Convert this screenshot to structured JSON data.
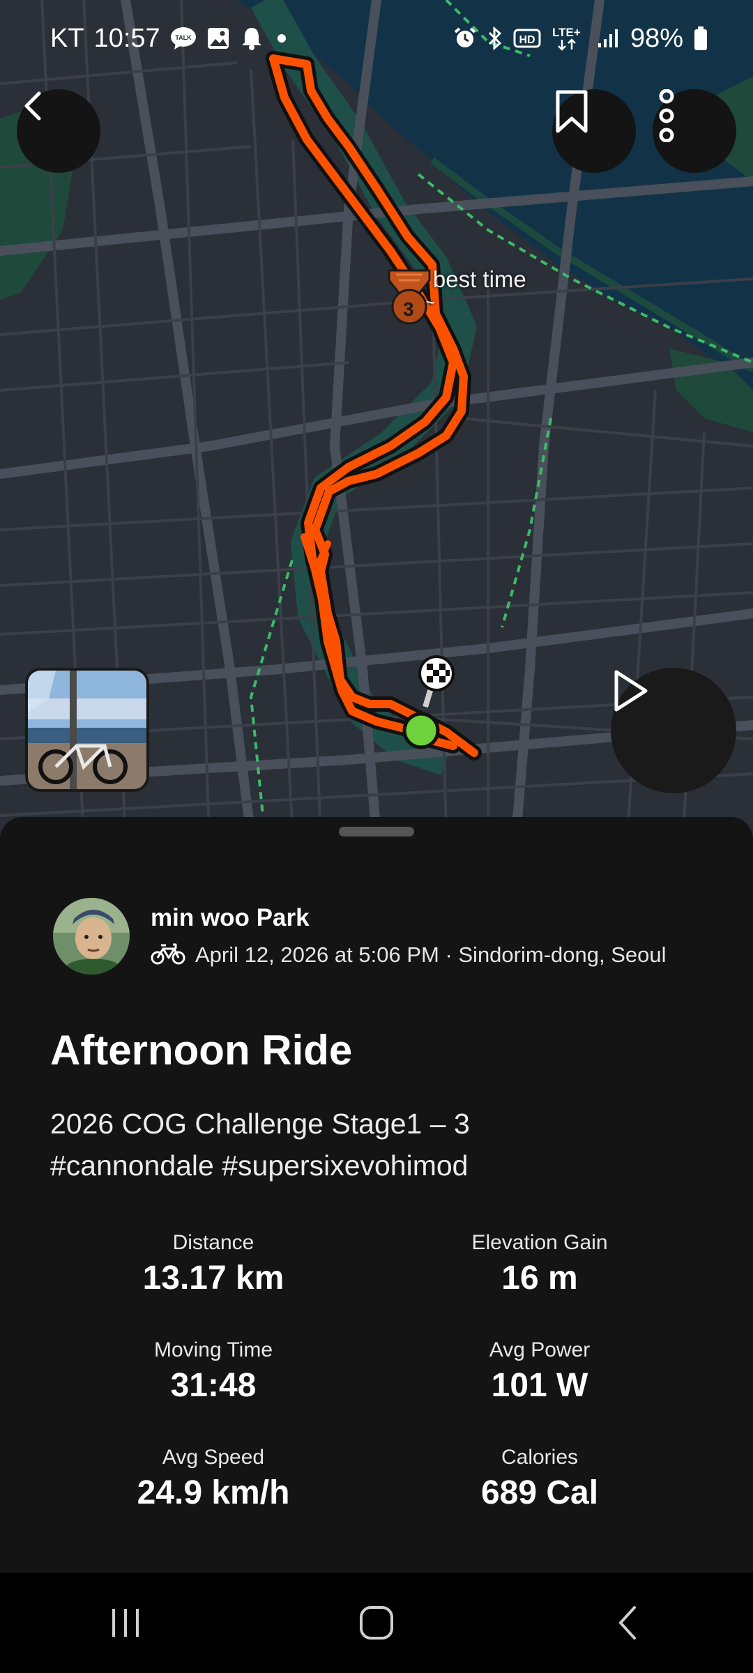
{
  "status_bar": {
    "carrier": "KT",
    "time": "10:57",
    "battery": "98%",
    "icons_left": [
      "kakaotalk-icon",
      "gallery-icon",
      "bell-icon",
      "dot"
    ],
    "icons_right": [
      "alarm-icon",
      "bluetooth-icon",
      "hd-icon",
      "lte-icon",
      "signal-icon",
      "battery-icon"
    ]
  },
  "map": {
    "achievement_label": "3rd best time",
    "achievement_sub": "~",
    "achievement_rank": "3",
    "route_color": "#fc5200",
    "water_color": "#123347",
    "start_color": "#6dd23c"
  },
  "athlete": {
    "name": "min woo Park",
    "activity_meta": "April 12, 2026 at 5:06 PM · Sindorim-dong, Seoul"
  },
  "activity": {
    "title": "Afternoon Ride",
    "description": "2026  COG Challenge Stage1 – 3\n#cannondale  #supersixevohimod"
  },
  "stats": [
    {
      "label": "Distance",
      "value": "13.17 km"
    },
    {
      "label": "Elevation Gain",
      "value": "16 m"
    },
    {
      "label": "Moving Time",
      "value": "31:48"
    },
    {
      "label": "Avg Power",
      "value": "101 W"
    },
    {
      "label": "Avg Speed",
      "value": "24.9 km/h"
    },
    {
      "label": "Calories",
      "value": "689 Cal"
    }
  ]
}
